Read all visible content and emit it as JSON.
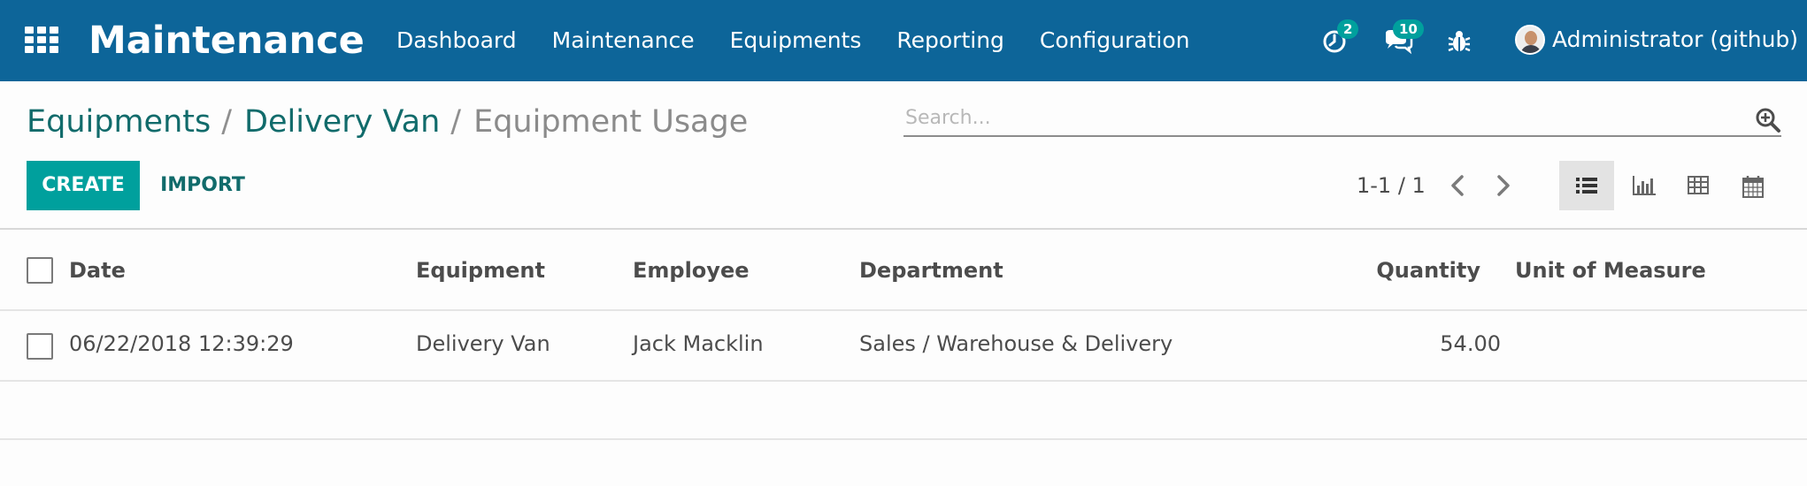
{
  "navbar": {
    "app_title": "Maintenance",
    "menu": [
      "Dashboard",
      "Maintenance",
      "Equipments",
      "Reporting",
      "Configuration"
    ],
    "activity_count": "2",
    "messages_count": "10",
    "user_name": "Administrator (github)"
  },
  "breadcrumb": {
    "items": [
      "Equipments",
      "Delivery Van"
    ],
    "current": "Equipment Usage",
    "separator": "/"
  },
  "search": {
    "placeholder": "Search..."
  },
  "buttons": {
    "create": "CREATE",
    "import": "IMPORT"
  },
  "pager": {
    "value": "1-1 / 1"
  },
  "views": {
    "active": "list",
    "available": [
      "list-icon",
      "graph-icon",
      "pivot-icon",
      "calendar-icon"
    ]
  },
  "table": {
    "columns": [
      "Date",
      "Equipment",
      "Employee",
      "Department",
      "Quantity",
      "Unit of Measure"
    ],
    "rows": [
      {
        "date": "06/22/2018 12:39:29",
        "equipment": "Delivery Van",
        "employee": "Jack Macklin",
        "department": "Sales / Warehouse & Delivery",
        "quantity": "54.00",
        "uom": ""
      }
    ]
  },
  "colors": {
    "navbar": "#0d6599",
    "primary": "#00a09d",
    "link": "#116b6b"
  }
}
